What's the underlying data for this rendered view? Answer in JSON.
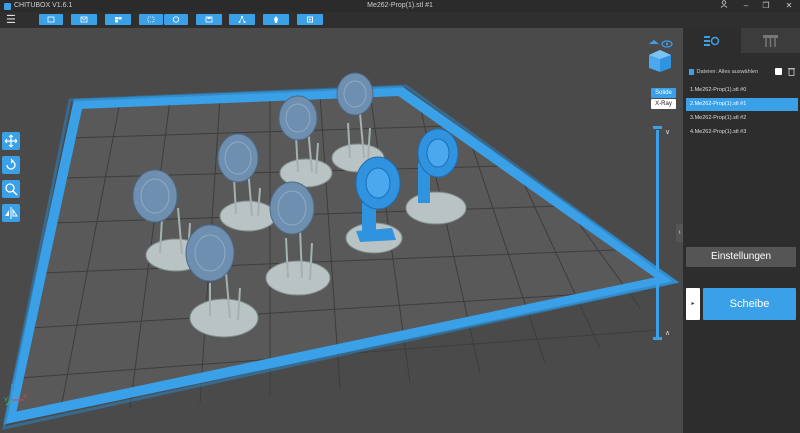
{
  "window": {
    "app_name": "CHITUBOX V1.6.1",
    "file_title": "Me262-Prop(1).stl #1",
    "controls": [
      "user-icon",
      "minimize-icon",
      "restore-icon",
      "close-icon"
    ]
  },
  "toolbar": {
    "buttons": [
      "open-file-icon",
      "mail-icon",
      "grid-icon",
      "select-icon",
      "copy-icon",
      "save-icon",
      "network-icon",
      "support-icon",
      "settings-icon"
    ]
  },
  "viewport": {
    "view_modes": {
      "solid": "Solide",
      "xray": "X-Ray"
    },
    "left_tools": [
      "move-icon",
      "rotate-icon",
      "scale-icon",
      "mirror-icon"
    ],
    "accent": "#3aa0e8",
    "axis_labels": {
      "x": "X",
      "y": "Y",
      "z": "Z"
    }
  },
  "panel": {
    "tabs": [
      "model-settings-icon",
      "support-icon"
    ],
    "files_label": "Dateien:",
    "select_all_label": "Alles auswählen",
    "files": [
      {
        "label": "1.Me262-Prop(1).stl #0",
        "selected": false
      },
      {
        "label": "2.Me262-Prop(1).stl #1",
        "selected": true
      },
      {
        "label": "3.Me262-Prop(1).stl #2",
        "selected": false
      },
      {
        "label": "4.Me262-Prop(1).stl #3",
        "selected": false
      }
    ],
    "settings_label": "Einstellungen",
    "slice_label": "Scheibe"
  }
}
